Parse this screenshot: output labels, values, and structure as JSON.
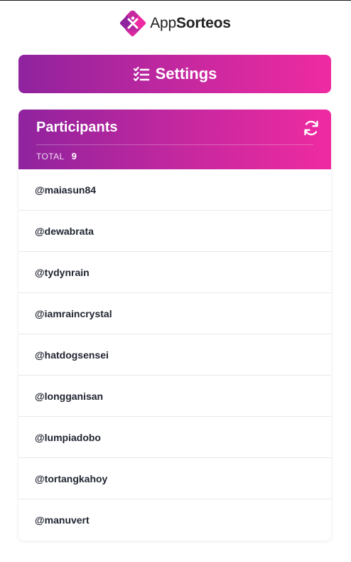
{
  "brand": {
    "name_light": "App",
    "name_bold": "Sorteos",
    "logo_icon": "appsorteos-logo-icon"
  },
  "settings_button": {
    "label": "Settings",
    "icon": "checklist-icon"
  },
  "participants": {
    "title": "Participants",
    "refresh_icon": "refresh-icon",
    "total_label": "TOTAL",
    "total_count": "9",
    "items": [
      "@maiasun84",
      "@dewabrata",
      "@tydynrain",
      "@iamraincrystal",
      "@hatdogsensei",
      "@longganisan",
      "@lumpiadobo",
      "@tortangkahoy",
      "@manuvert"
    ]
  },
  "colors": {
    "gradient_start": "#8f239e",
    "gradient_end": "#ef2aa1"
  }
}
